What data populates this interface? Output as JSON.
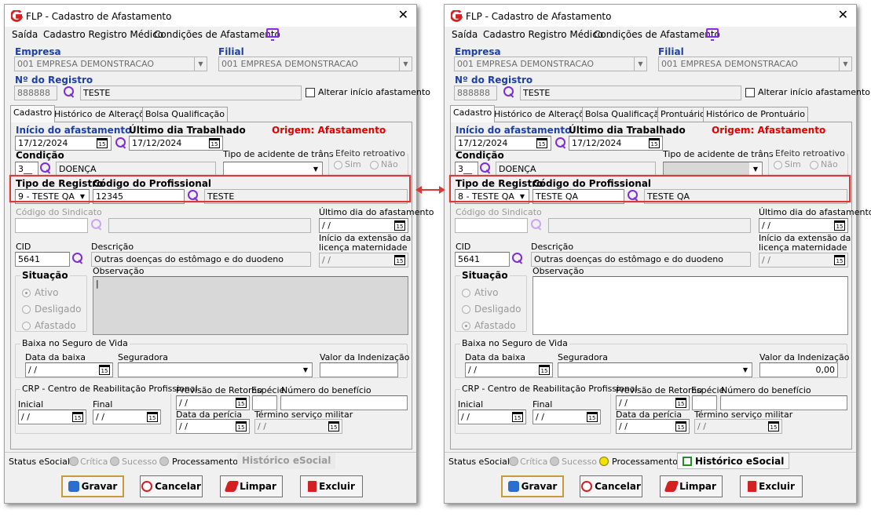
{
  "windows": [
    {
      "title": "FLP - Cadastro de Afastamento",
      "menu": {
        "saida": "Saída",
        "cadastro_registro_medico": "Cadastro Registro Médico",
        "condicoes": "Condições de Afastamento"
      },
      "empresa": {
        "label": "Empresa",
        "value": "001 EMPRESA DEMONSTRACAO"
      },
      "filial": {
        "label": "Filial",
        "value": "001 EMPRESA DEMONSTRACAO"
      },
      "registro": {
        "label": "Nº do Registro",
        "number": "888888",
        "name": "TESTE"
      },
      "alterar_inicio": "Alterar início afastamento",
      "tabs": [
        "Cadastro",
        "Histórico de Alterações",
        "Bolsa Qualificação"
      ],
      "inicio": {
        "label": "Início do afastamento",
        "value": "17/12/2024"
      },
      "ultimo": {
        "label": "Último dia Trabalhado",
        "value": "17/12/2024"
      },
      "origem": "Origem: Afastamento",
      "condicao": {
        "label": "Condição",
        "code": "3",
        "desc": "DOENÇA"
      },
      "tipo_acidente": {
        "label": "Tipo de acidente de trânsito",
        "value": ""
      },
      "efeito": {
        "label": "Efeito retroativo",
        "sim": "Sim",
        "nao": "Não"
      },
      "tipo_registro": {
        "label": "Tipo de Registro",
        "value": "9 - TESTE QA"
      },
      "codigo_profissional": {
        "label": "Código do Profissional",
        "code": "12345",
        "name": "TESTE"
      },
      "codigo_sindicato": "Código do Sindicato",
      "ultimo_dia_afast": {
        "label": "Último dia do afastamento",
        "value": " / /"
      },
      "cid": {
        "label": "CID",
        "value": "5641"
      },
      "descricao": {
        "label": "Descrição",
        "value": "Outras doenças do estômago e do duodeno"
      },
      "extensao": {
        "label1": "Início da extensão da",
        "label2": "licença maternidade",
        "value": " / /"
      },
      "situacao": {
        "label": "Situação",
        "ativo": "Ativo",
        "desligado": "Desligado",
        "afastado": "Afastado",
        "selected": "ativo"
      },
      "observacao": {
        "label": "Observação",
        "value": "|"
      },
      "seguro": {
        "label": "Baixa no Seguro de Vida",
        "data_label": "Data da baixa",
        "data_value": " / /",
        "seguradora": "Seguradora",
        "valor_label": "Valor da Indenização",
        "valor": ""
      },
      "crp": {
        "label": "CRP - Centro de Reabilitação Profissional",
        "inicial": "Inicial",
        "inicial_value": " / /",
        "final": "Final",
        "final_value": " / /"
      },
      "previsao": {
        "label": "Previsão de Retorno",
        "value": " / /"
      },
      "especie": "Espécie",
      "numero_beneficio": "Número do benefício",
      "data_pericia": {
        "label": "Data da perícia",
        "value": " / /"
      },
      "termino": {
        "label": "Término serviço militar",
        "value": " / /"
      },
      "status": {
        "label": "Status eSocial:",
        "critica": "Crítica",
        "sucesso": "Sucesso",
        "processamento": "Processamento",
        "historico": "Histórico eSocial"
      },
      "buttons": {
        "gravar": "Gravar",
        "cancelar": "Cancelar",
        "limpar": "Limpar",
        "excluir": "Excluir"
      }
    },
    {
      "title": "FLP - Cadastro de Afastamento",
      "menu": {
        "saida": "Saída",
        "cadastro_registro_medico": "Cadastro Registro Médico",
        "condicoes": "Condições de Afastamento"
      },
      "empresa": {
        "label": "Empresa",
        "value": "001 EMPRESA DEMONSTRACAO"
      },
      "filial": {
        "label": "Filial",
        "value": "001 EMPRESA DEMONSTRACAO"
      },
      "registro": {
        "label": "Nº do Registro",
        "number": "888888",
        "name": "TESTE"
      },
      "alterar_inicio": "Alterar início afastamento",
      "tabs": [
        "Cadastro",
        "Histórico de Alterações",
        "Bolsa Qualificação",
        "Prontuário",
        "Histórico de Prontuário"
      ],
      "inicio": {
        "label": "Início do afastamento",
        "value": "17/12/2024"
      },
      "ultimo": {
        "label": "Último dia Trabalhado",
        "value": "17/12/2024"
      },
      "origem": "Origem: Afastamento",
      "condicao": {
        "label": "Condição",
        "code": "3",
        "desc": "DOENÇA"
      },
      "tipo_acidente": {
        "label": "Tipo de acidente de trânsito",
        "value": ""
      },
      "efeito": {
        "label": "Efeito retroativo",
        "sim": "Sim",
        "nao": "Não"
      },
      "tipo_registro": {
        "label": "Tipo de Registro",
        "value": "8 - TESTE QA"
      },
      "codigo_profissional": {
        "label": "Código do Profissional",
        "code": "TESTE QA",
        "name": "TESTE QA"
      },
      "codigo_sindicato": "Código do Sindicato",
      "ultimo_dia_afast": {
        "label": "Último dia do afastamento",
        "value": " / /"
      },
      "cid": {
        "label": "CID",
        "value": "5641"
      },
      "descricao": {
        "label": "Descrição",
        "value": "Outras doenças do estômago e do duodeno"
      },
      "extensao": {
        "label1": "Início da extensão da",
        "label2": "licença maternidade",
        "value": " / /"
      },
      "situacao": {
        "label": "Situação",
        "ativo": "Ativo",
        "desligado": "Desligado",
        "afastado": "Afastado",
        "selected": "afastado"
      },
      "observacao": {
        "label": "Observação",
        "value": ""
      },
      "seguro": {
        "label": "Baixa no Seguro de Vida",
        "data_label": "Data da baixa",
        "data_value": " / /",
        "seguradora": "Seguradora",
        "valor_label": "Valor da Indenização",
        "valor": "0,00"
      },
      "crp": {
        "label": "CRP - Centro de Reabilitação Profissional",
        "inicial": "Inicial",
        "inicial_value": " / /",
        "final": "Final",
        "final_value": " / /"
      },
      "previsao": {
        "label": "Previsão de Retorno",
        "value": " / /"
      },
      "especie": "Espécie",
      "numero_beneficio": "Número do benefício",
      "data_pericia": {
        "label": "Data da perícia",
        "value": " / /"
      },
      "termino": {
        "label": "Término serviço militar",
        "value": " / /"
      },
      "status": {
        "label": "Status eSocial:",
        "critica": "Crítica",
        "sucesso": "Sucesso",
        "processamento": "Processamento",
        "historico": "Histórico eSocial"
      },
      "buttons": {
        "gravar": "Gravar",
        "cancelar": "Cancelar",
        "limpar": "Limpar",
        "excluir": "Excluir"
      }
    }
  ],
  "colors": {
    "highlight": "#d83a3a",
    "label_blue": "#1f3fa5",
    "origin_red": "#e00000",
    "icon_purple": "#7b2fd4"
  }
}
